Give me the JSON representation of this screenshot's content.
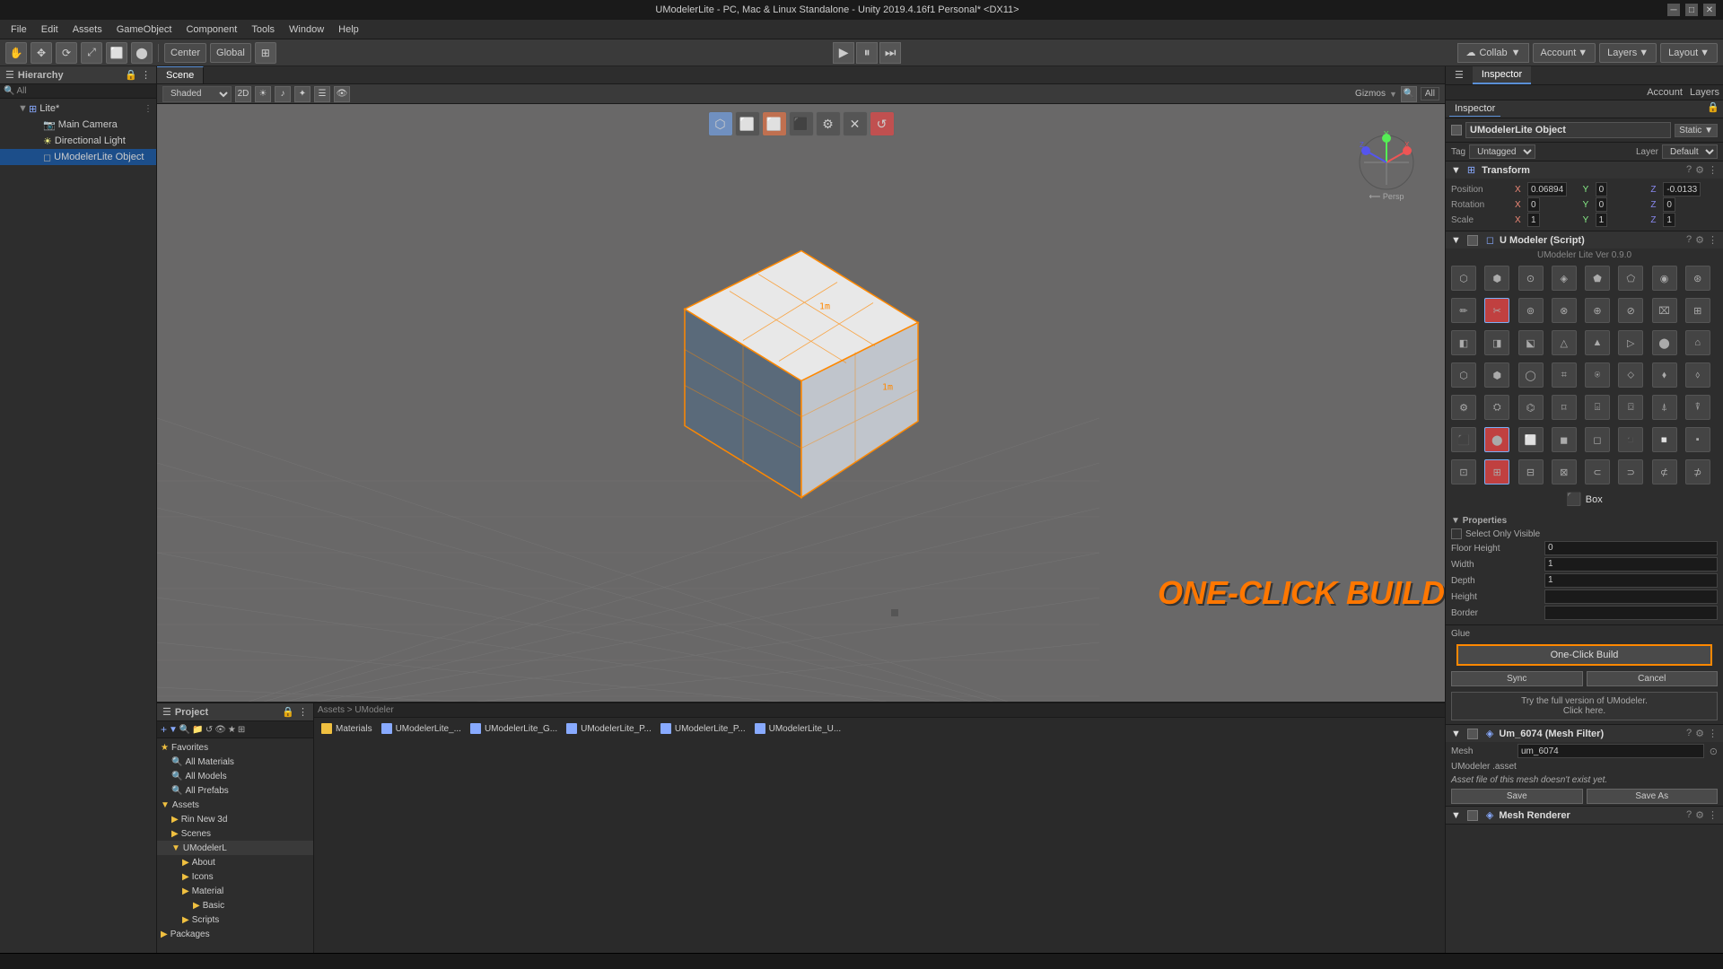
{
  "window": {
    "title": "UModelerLite - PC, Mac & Linux Standalone - Unity 2019.4.16f1 Personal* <DX11>"
  },
  "menu": {
    "items": [
      "File",
      "Edit",
      "Assets",
      "GameObject",
      "Component",
      "Tools",
      "Window",
      "Help"
    ]
  },
  "toolbar": {
    "tools": [
      "⬜",
      "✥",
      "⟳",
      "⤢",
      "⬤"
    ],
    "center_label": "Center",
    "global_label": "Global",
    "play": "▶",
    "pause": "⏸",
    "step": "⏭",
    "collab": "Collab",
    "account": "Account",
    "layers": "Layers",
    "layout": "Layout"
  },
  "hierarchy": {
    "title": "Hierarchy",
    "all_label": "All",
    "scene_name": "Lite*",
    "objects": [
      {
        "name": "Main Camera",
        "indent": 1,
        "type": "camera"
      },
      {
        "name": "Directional Light",
        "indent": 1,
        "type": "light"
      },
      {
        "name": "UModelerLite Object",
        "indent": 1,
        "type": "object",
        "selected": true
      }
    ]
  },
  "scene": {
    "tab": "Scene",
    "shading": "Shaded",
    "view_mode": "2D",
    "gizmos": "Gizmos",
    "all_label": "All",
    "persp": "Persp"
  },
  "inspector": {
    "title": "Inspector",
    "tabs": [
      "Inspector"
    ],
    "object_name": "UModelerLite Object",
    "static_label": "Static",
    "tag": "Untagged",
    "layer": "Default",
    "transform": {
      "title": "Transform",
      "position": {
        "x": "0.06894",
        "y": "0",
        "z": "-0.0133"
      },
      "rotation": {
        "x": "0",
        "y": "0",
        "z": "0"
      },
      "scale": {
        "x": "1",
        "y": "1",
        "z": "1"
      }
    },
    "umodeler": {
      "title": "U Modeler (Script)",
      "version": "UModeler Lite Ver 0.9.0"
    },
    "properties": {
      "title": "Properties",
      "select_only_visible": "Select Only Visible",
      "floor_height": "Floor Height",
      "floor_height_val": "0",
      "width": "Width",
      "width_val": "1",
      "depth": "Depth",
      "depth_val": "1",
      "height": "Height",
      "border": "Border"
    },
    "glue": "Glue",
    "one_click_build": "One-Click Build",
    "sync": "Sync",
    "cancel": "Cancel",
    "try_full": "Try the full version of UModeler.\nClick here.",
    "mesh_filter": {
      "title": "Um_6074 (Mesh Filter)",
      "mesh_label": "Mesh",
      "mesh_val": "um_6074",
      "asset_label": "UModeler .asset",
      "warning": "Asset file of this mesh doesn't exist yet.",
      "save": "Save",
      "save_as": "Save As"
    },
    "mesh_renderer": {
      "title": "Mesh Renderer"
    }
  },
  "project": {
    "title": "Project",
    "favorites": {
      "label": "Favorites",
      "items": [
        "All Materials",
        "All Models",
        "All Prefabs"
      ]
    },
    "assets": {
      "label": "Assets",
      "folders": [
        "Rin New 3d",
        "Scenes",
        "UModelerL"
      ]
    },
    "packages": {
      "label": "Packages"
    }
  },
  "files": {
    "path": "Assets > UModeler",
    "items": [
      "Materials",
      "UModelerLite_...",
      "UModelerLite_G...",
      "UModelerLite_P...",
      "UModelerLite_P...",
      "UModelerLite_U..."
    ]
  },
  "about": {
    "label": "About"
  },
  "one_click_text": "ONE-CLICK BUILD"
}
